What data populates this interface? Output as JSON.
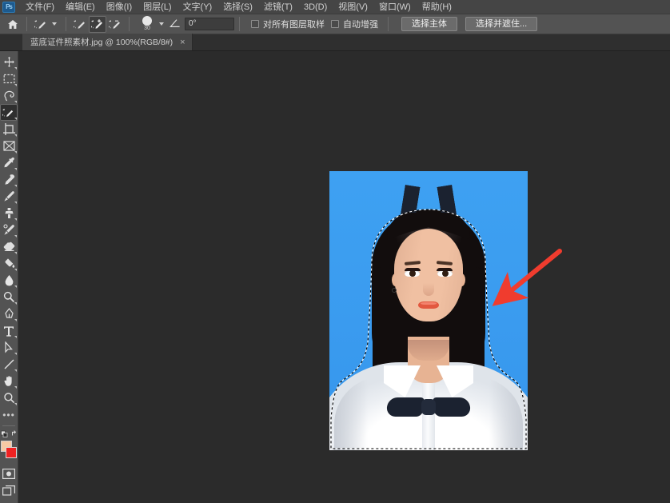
{
  "app": {
    "name": "Adobe Photoshop",
    "logo_text": "Ps"
  },
  "menubar": {
    "items": [
      {
        "label": "文件(F)",
        "name": "menu-file"
      },
      {
        "label": "编辑(E)",
        "name": "menu-edit"
      },
      {
        "label": "图像(I)",
        "name": "menu-image"
      },
      {
        "label": "图层(L)",
        "name": "menu-layer"
      },
      {
        "label": "文字(Y)",
        "name": "menu-type"
      },
      {
        "label": "选择(S)",
        "name": "menu-select"
      },
      {
        "label": "滤镜(T)",
        "name": "menu-filter"
      },
      {
        "label": "3D(D)",
        "name": "menu-3d"
      },
      {
        "label": "视图(V)",
        "name": "menu-view"
      },
      {
        "label": "窗口(W)",
        "name": "menu-window"
      },
      {
        "label": "帮助(H)",
        "name": "menu-help"
      }
    ]
  },
  "options_bar": {
    "home_icon": "home-icon",
    "tool_preset_icon": "quick-selection-icon",
    "mode_new_icon": "selection-new-icon",
    "mode_add_icon": "selection-add-icon",
    "mode_subtract_icon": "selection-subtract-icon",
    "active_mode": "selection-add-icon",
    "brush_size": "30",
    "angle_value": "0°",
    "angle_icon": "angle-icon",
    "sample_all_layers_label": "对所有图层取样",
    "sample_all_layers_checked": false,
    "auto_enhance_label": "自动增强",
    "auto_enhance_checked": false,
    "select_subject_label": "选择主体",
    "select_and_mask_label": "选择并遮住..."
  },
  "tab_bar": {
    "tabs": [
      {
        "title": "蓝底证件照素材.jpg @ 100%(RGB/8#)",
        "close_glyph": "×",
        "active": true
      }
    ]
  },
  "toolbar": {
    "tools": [
      {
        "name": "move-tool",
        "icon": "move-icon",
        "active": false
      },
      {
        "name": "rectangular-marquee-tool",
        "icon": "marquee-icon",
        "active": false
      },
      {
        "name": "lasso-tool",
        "icon": "lasso-icon",
        "active": false
      },
      {
        "name": "quick-selection-tool",
        "icon": "quick-selection-icon",
        "active": true
      },
      {
        "name": "crop-tool",
        "icon": "crop-icon",
        "active": false
      },
      {
        "name": "frame-tool",
        "icon": "frame-icon",
        "active": false
      },
      {
        "name": "eyedropper-tool",
        "icon": "eyedropper-icon",
        "active": false
      },
      {
        "name": "spot-healing-brush-tool",
        "icon": "healing-brush-icon",
        "active": false
      },
      {
        "name": "brush-tool",
        "icon": "brush-icon",
        "active": false
      },
      {
        "name": "clone-stamp-tool",
        "icon": "clone-stamp-icon",
        "active": false
      },
      {
        "name": "history-brush-tool",
        "icon": "history-brush-icon",
        "active": false
      },
      {
        "name": "eraser-tool",
        "icon": "eraser-icon",
        "active": false
      },
      {
        "name": "gradient-tool",
        "icon": "paint-bucket-icon",
        "active": false
      },
      {
        "name": "blur-tool",
        "icon": "blur-drop-icon",
        "active": false
      },
      {
        "name": "dodge-tool",
        "icon": "dodge-icon",
        "active": false
      },
      {
        "name": "pen-tool",
        "icon": "pen-icon",
        "active": false
      },
      {
        "name": "horizontal-type-tool",
        "icon": "text-T-icon",
        "active": false
      },
      {
        "name": "path-selection-tool",
        "icon": "path-arrow-icon",
        "active": false
      },
      {
        "name": "line-shape-tool",
        "icon": "line-icon",
        "active": false
      },
      {
        "name": "hand-tool",
        "icon": "hand-icon",
        "active": false
      },
      {
        "name": "zoom-tool",
        "icon": "magnifier-icon",
        "active": false
      },
      {
        "name": "edit-toolbar-more",
        "icon": "ellipsis-icon",
        "active": false
      }
    ],
    "color_swatches": {
      "name": "foreground-background-color",
      "foreground_hex": "#F6C9A4",
      "background_hex": "#EF2222",
      "swap_icon": "swap-colors-icon",
      "default_icon": "default-colors-icon"
    },
    "quick_mask_icon": "quick-mask-icon",
    "screen_mode_icon": "screen-mode-icon"
  },
  "canvas": {
    "background_hex": "#2B2B2B",
    "document": {
      "name": "portrait-id-photo",
      "background_hex": "#3B9CEE",
      "shirt_hex": "#FFFFFF",
      "hair_hex": "#120D0D",
      "skin_hex": "#F0C0A2",
      "lip_hex": "#E2583F",
      "bowtie_hex": "#1B2230",
      "selection_active": true,
      "selection_style": "marching-ants"
    },
    "annotation": {
      "name": "red-arrow-annotation",
      "color_hex": "#F03C2E",
      "direction": "points-down-left-to-selection-edge"
    }
  }
}
